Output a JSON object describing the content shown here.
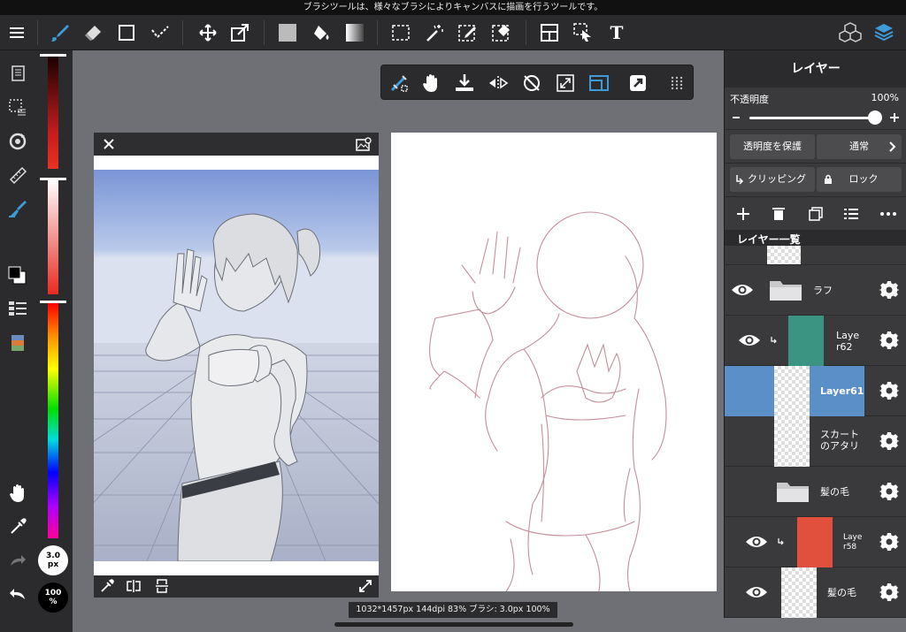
{
  "message_bar": "ブラシツールは、様々なブラシによりキャンバスに描画を行うツールです。",
  "toolbar": {
    "icons": [
      "menu-icon",
      "brush-icon",
      "eraser-icon",
      "rectangle-icon",
      "dot-icon",
      "move-icon",
      "transform-icon",
      "fill-color-icon",
      "bucket-icon",
      "gradient-icon",
      "select-rect-icon",
      "magic-wand-icon",
      "select-pen-icon",
      "select-eraser-icon",
      "layout-icon",
      "operate-icon",
      "text-icon",
      "3d-icon",
      "layers-icon"
    ],
    "text_tool_label": "T"
  },
  "left_tools": {
    "brush_size": "3.0\npx",
    "brush_size_value": "3.0",
    "brush_size_unit": "px",
    "opacity_value": "100",
    "opacity_unit": "%"
  },
  "canvas_toolbar": {
    "icons": [
      "snap-icon",
      "hand-icon",
      "import-icon",
      "flip-icon",
      "rotate-reset-icon",
      "fit-icon",
      "screen-mode-icon",
      "quick-icon",
      "grid-icon"
    ]
  },
  "status": "1032*1457px 144dpi 83% ブラシ: 3.0px 100%",
  "right_panel": {
    "title": "レイヤー",
    "opacity_label": "不透明度",
    "opacity_value": "100%",
    "opacity": 1.0,
    "protect_button": "透明度を保護",
    "blend_mode": "通常",
    "clipping_button": "クリッピング",
    "lock_button": "ロック",
    "list_title": "レイヤー一覧",
    "layers": [
      {
        "name": "ラフ",
        "type": "folder"
      },
      {
        "name": "Laye\nr62",
        "name_l1": "Laye",
        "name_l2": "r62",
        "color": "#3b9482",
        "clip": true
      },
      {
        "name": "Layer61",
        "selected": true
      },
      {
        "name_l1": "スカート",
        "name_l2": "のアタリ"
      },
      {
        "name": "髪の毛",
        "type": "folder"
      },
      {
        "name_l1": "Laye",
        "name_l2": "r58",
        "color": "#e0503d",
        "clip": true
      },
      {
        "name": "髪の毛"
      }
    ]
  },
  "colors": {
    "accent": "#3f9bd8",
    "selected_layer": "#5b8fc8",
    "panel_bg": "#2b2b2d"
  }
}
